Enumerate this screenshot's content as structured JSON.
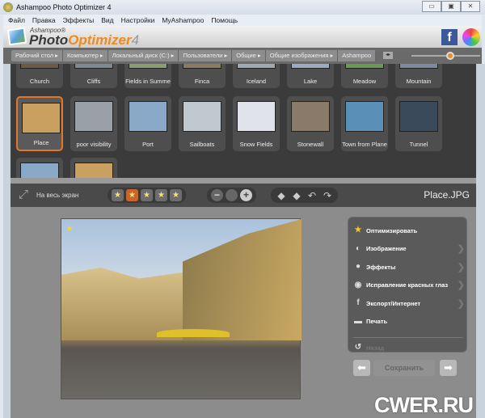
{
  "window": {
    "title": "Ashampoo Photo Optimizer 4",
    "controls": [
      "▭",
      "▣",
      "✕"
    ]
  },
  "menu": [
    "Файл",
    "Правка",
    "Эффекты",
    "Вид",
    "Настройки",
    "MyAshampoo",
    "Помощь"
  ],
  "logo": {
    "small": "Ashampoo®",
    "main1": "Photo",
    "main2": "Optimizer",
    "ver": "4"
  },
  "breadcrumb": [
    "Рабочий стол ▸",
    "Компьютер ▸",
    "Локальный диск (C:) ▸",
    "Пользователи ▸",
    "Общие ▸",
    "Общие изображения ▸",
    "Ashampoo"
  ],
  "thumb_size_slider": 0.5,
  "thumbnails_row1": [
    "Church",
    "Cliffs",
    "Fields in Summe",
    "Finca",
    "Iceland",
    "Lake",
    "Meadow",
    "Mountain"
  ],
  "thumbnails_row2": [
    "Place",
    "poor visibility",
    "Port",
    "Sailboats",
    "Snow Fields",
    "Stonewall",
    "Town from Plane",
    "Tunnel"
  ],
  "selected_thumbnail": "Place",
  "toolbar": {
    "fullscreen": "На весь экран",
    "rating_selected": 1,
    "filename": "Place.JPG"
  },
  "actions": [
    {
      "label": "Оптимизировать",
      "icon": "star-icon",
      "glyph": "★",
      "chevron": false
    },
    {
      "label": "Изображение",
      "icon": "image-adjust-icon",
      "glyph": "◐",
      "chevron": true
    },
    {
      "label": "Эффекты",
      "icon": "effects-icon",
      "glyph": "●",
      "chevron": true
    },
    {
      "label": "Исправление красных глаз",
      "icon": "eye-icon",
      "glyph": "◉",
      "chevron": true
    },
    {
      "label": "Экспорт/Интернет",
      "icon": "facebook-icon",
      "glyph": "f",
      "chevron": true
    },
    {
      "label": "Печать",
      "icon": "printer-icon",
      "glyph": "▬",
      "chevron": false
    }
  ],
  "back": "Назад",
  "save": "Сохранить",
  "watermark": "CWER.RU",
  "colors": {
    "accent": "#f08a1c",
    "selection": "#e2772a"
  }
}
